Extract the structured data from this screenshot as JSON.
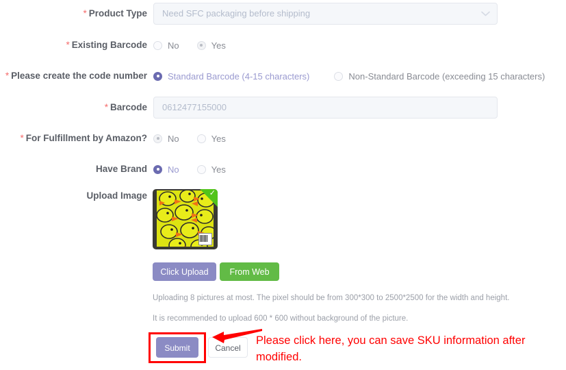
{
  "form": {
    "rows": [
      {
        "label": "Product Type",
        "required": true,
        "type": "select",
        "value": "Need SFC packaging before shipping",
        "icon": "chevron-down-icon",
        "disabled": true
      },
      {
        "label": "Existing Barcode",
        "required": true,
        "type": "radio",
        "disabled": true,
        "options": [
          {
            "label": "No",
            "selected": false
          },
          {
            "label": "Yes",
            "selected": true
          }
        ]
      },
      {
        "label": "Please create the code number",
        "required": true,
        "type": "radio",
        "disabled": false,
        "options": [
          {
            "label": "Standard Barcode (4-15 characters)",
            "selected": true
          },
          {
            "label": "Non-Standard Barcode (exceeding 15 characters)",
            "selected": false
          }
        ]
      },
      {
        "label": "Barcode",
        "required": true,
        "type": "text",
        "value": "0612477155000",
        "disabled": true
      },
      {
        "label": "For Fulfillment by Amazon?",
        "required": true,
        "type": "radio",
        "disabled": true,
        "options": [
          {
            "label": "No",
            "selected": true
          },
          {
            "label": "Yes",
            "selected": false
          }
        ]
      },
      {
        "label": "Have Brand",
        "required": false,
        "type": "radio",
        "disabled": false,
        "options": [
          {
            "label": "No",
            "selected": true
          },
          {
            "label": "Yes",
            "selected": false
          }
        ]
      }
    ]
  },
  "upload": {
    "label": "Upload Image",
    "thumbnail_alt": "product-photo-yellow-duck-notebook",
    "thumbnail_badge": "check-icon",
    "click_upload_label": "Click Upload",
    "from_web_label": "From Web",
    "hint": "Uploading 8 pictures at most. The pixel should be from 300*300 to 2500*2500 for the width and height. It is recommended to upload 600 * 600 without background of the picture."
  },
  "footer": {
    "submit_label": "Submit",
    "cancel_label": "Cancel"
  },
  "annotation": {
    "text": "Please click here, you can save SKU information after modified.",
    "color": "#ff0000"
  },
  "colors": {
    "accent_purple": "#8b8bc4",
    "radio_checked": "#6b6bb0",
    "green_button": "#62bb46",
    "badge_green": "#52c41a",
    "required_star": "#f56c6c",
    "annotation_red": "#ff0000",
    "input_bg": "#f5f7fa",
    "input_border": "#e4e7ed",
    "label_text": "#5a5e66"
  }
}
